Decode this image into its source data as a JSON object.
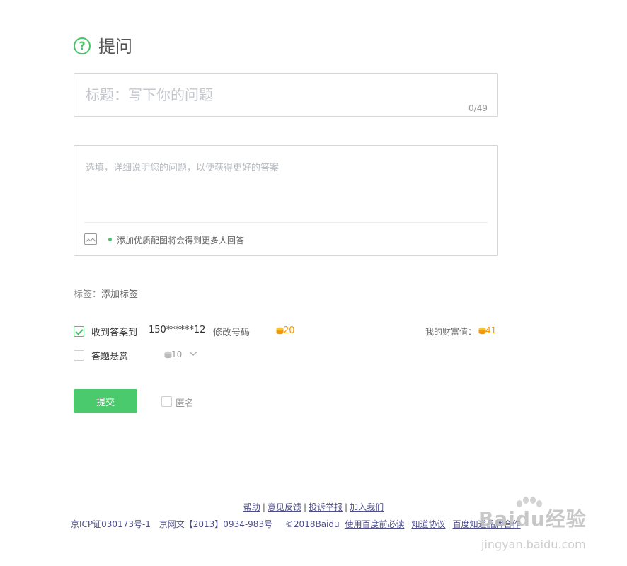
{
  "header": {
    "icon": "question-circle-icon",
    "icon_glyph": "?",
    "title": "提问"
  },
  "title_field": {
    "value": "",
    "placeholder": "标题：写下你的问题",
    "counter": "0/49"
  },
  "detail_field": {
    "value": "",
    "placeholder": "选填，详细说明您的问题，以便获得更好的答案",
    "image_icon": "image-icon",
    "tip": "添加优质配图将会得到更多人回答"
  },
  "tags": {
    "label": "标签：",
    "add_link": "添加标签"
  },
  "notify": {
    "checked": true,
    "label": "收到答案到",
    "phone": "150******12",
    "modify_link": "修改号码",
    "coin_amount": "20",
    "wealth_label": "我的财富值：",
    "wealth_value": "41"
  },
  "reward": {
    "checked": false,
    "label": "答题悬赏",
    "amount": "10",
    "dropdown_icon": "chevron-down-icon"
  },
  "submit": {
    "label": "提交"
  },
  "anonymous": {
    "checked": false,
    "label": "匿名"
  },
  "footer": {
    "links1": [
      "帮助",
      "意见反馈",
      "投诉举报",
      "加入我们"
    ],
    "icp": "京ICP证030173号-1",
    "wenhua": "京网文【2013】0934-983号",
    "copyright": "©2018Baidu",
    "links2": [
      "使用百度前必读",
      "知道协议",
      "百度知道品牌合作"
    ]
  },
  "watermark": {
    "logo": "Baidu经验",
    "url": "jingyan.baidu.com"
  },
  "colors": {
    "accent": "#49c36a",
    "button": "#4ac96d",
    "coin": "#f39800",
    "link": "#4e4e88"
  }
}
